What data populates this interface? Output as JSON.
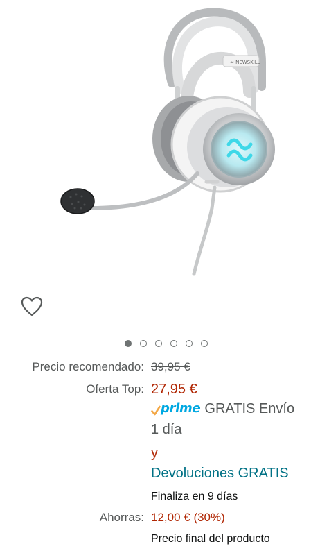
{
  "pricing": {
    "list_label": "Precio recomendado:",
    "list_price": "39,95 €",
    "deal_label": "Oferta Top:",
    "deal_price": "27,95 €",
    "prime_word": "prime",
    "shipping_text": "GRATIS Envío",
    "shipping_days": "1 día",
    "and_text": "y",
    "returns_text": "Devoluciones GRATIS",
    "ends_text": "Finaliza en 9 días",
    "savings_label": "Ahorras:",
    "savings_value": "12,00 € (30%)",
    "final_price_text": "Precio final del producto"
  },
  "carousel": {
    "total_images": 6,
    "active_index": 0
  },
  "colors": {
    "price_red": "#b12704",
    "link_teal": "#007185",
    "prime_blue": "#00a8e1",
    "prime_check": "#f3a847",
    "muted_text": "#565959",
    "headset_cyan": "#3fd8e8"
  },
  "icons": {
    "wishlist": "heart-outline-icon",
    "prime_check": "check-icon"
  }
}
